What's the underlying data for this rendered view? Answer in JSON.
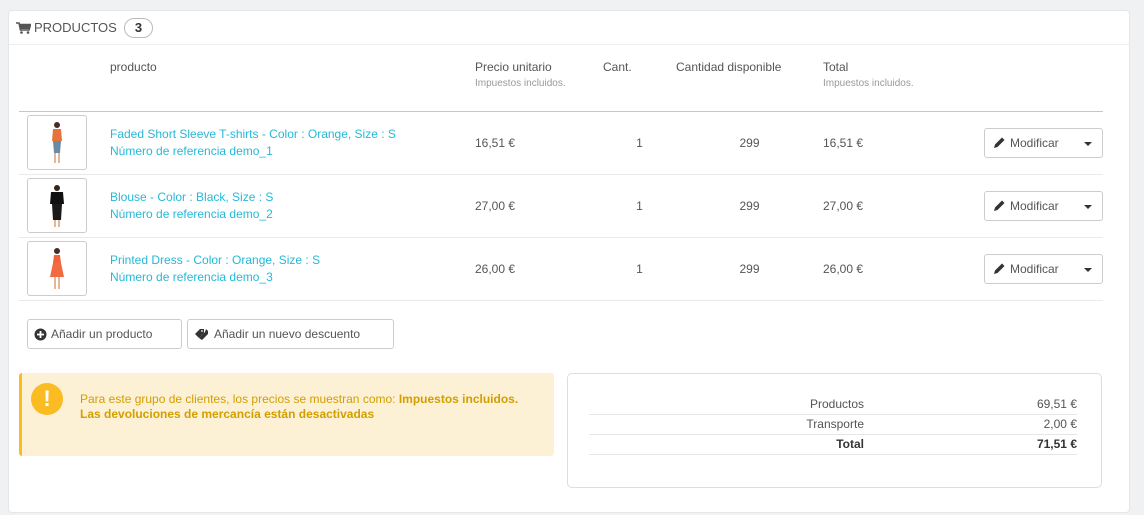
{
  "panel": {
    "title": "PRODUCTOS",
    "count": "3"
  },
  "columns": {
    "product": "producto",
    "unit_price": "Precio unitario",
    "unit_price_sub": "Impuestos incluidos.",
    "qty": "Cant.",
    "available": "Cantidad disponible",
    "total": "Total",
    "total_sub": "Impuestos incluidos."
  },
  "rows": [
    {
      "name": "Faded Short Sleeve T-shirts - Color : Orange, Size : S",
      "ref": "Número de referencia demo_1",
      "price": "16,51 €",
      "qty": "1",
      "available": "299",
      "total": "16,51 €",
      "action": "Modificar",
      "thumb_icon": "tshirt-product-image"
    },
    {
      "name": "Blouse - Color : Black, Size : S",
      "ref": "Número de referencia demo_2",
      "price": "27,00 €",
      "qty": "1",
      "available": "299",
      "total": "27,00 €",
      "action": "Modificar",
      "thumb_icon": "blouse-product-image"
    },
    {
      "name": "Printed Dress - Color : Orange, Size : S",
      "ref": "Número de referencia demo_3",
      "price": "26,00 €",
      "qty": "1",
      "available": "299",
      "total": "26,00 €",
      "action": "Modificar",
      "thumb_icon": "dress-product-image"
    }
  ],
  "actions": {
    "add_product": "Añadir un producto",
    "add_discount": "Añadir un nuevo descuento"
  },
  "alert": {
    "text": "Para este grupo de clientes, los precios se muestran como: ",
    "bold": "Impuestos incluidos.",
    "returns": "Las devoluciones de mercancía están desactivadas"
  },
  "totals": {
    "products_label": "Productos",
    "products_value": "69,51 €",
    "shipping_label": "Transporte",
    "shipping_value": "2,00 €",
    "total_label": "Total",
    "total_value": "71,51 €"
  },
  "colors": {
    "link": "#25b9d7",
    "warning": "#fbbb22",
    "warning_bg": "#fcf1d4"
  }
}
